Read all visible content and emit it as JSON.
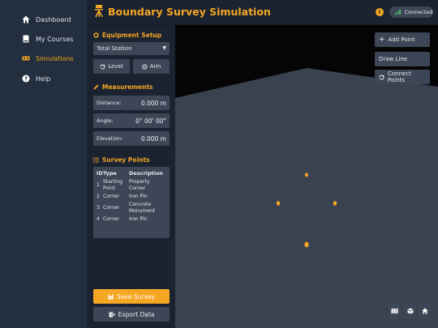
{
  "nav": {
    "items": [
      {
        "label": "Dashboard",
        "icon": "home-icon"
      },
      {
        "label": "My Courses",
        "icon": "book-icon"
      },
      {
        "label": "Simulations",
        "icon": "vr-headset-icon"
      },
      {
        "label": "Help",
        "icon": "question-icon"
      }
    ],
    "active_index": 2
  },
  "header": {
    "title": "Boundary Survey Simulation",
    "status": "Connected"
  },
  "equipment": {
    "heading": "Equipment Setup",
    "selected": "Total Station",
    "level_label": "Level",
    "aim_label": "Aim"
  },
  "measurements": {
    "heading": "Measurements",
    "rows": [
      {
        "label": "Distance:",
        "value": "0.000 m"
      },
      {
        "label": "Angle:",
        "value": "0° 00' 00\""
      },
      {
        "label": "Elevation:",
        "value": "0.000 m"
      }
    ]
  },
  "survey_points": {
    "heading": "Survey Points",
    "columns": [
      "ID",
      "Type",
      "Description"
    ],
    "rows": [
      {
        "id": "1",
        "type": "Starting Point",
        "description": "Property Corner"
      },
      {
        "id": "2",
        "type": "Corner",
        "description": "Iron Pin"
      },
      {
        "id": "3",
        "type": "Corner",
        "description": "Concrete Monument"
      },
      {
        "id": "4",
        "type": "Corner",
        "description": "Iron Pin"
      }
    ]
  },
  "actions": {
    "save_label": "Save Survey",
    "export_label": "Export Data"
  },
  "viewport_tools": {
    "add_point": "Add Point",
    "draw_line": "Draw Line",
    "connect_points": "Connect Points"
  },
  "view_controls": [
    "map-icon",
    "cube-icon",
    "home-icon"
  ],
  "colors": {
    "accent": "#f5a623",
    "sidebar": "#232e3e",
    "panel": "#1b2331",
    "control": "#3c4656",
    "ground": "#3a4250",
    "status_green": "#3ec46d"
  }
}
